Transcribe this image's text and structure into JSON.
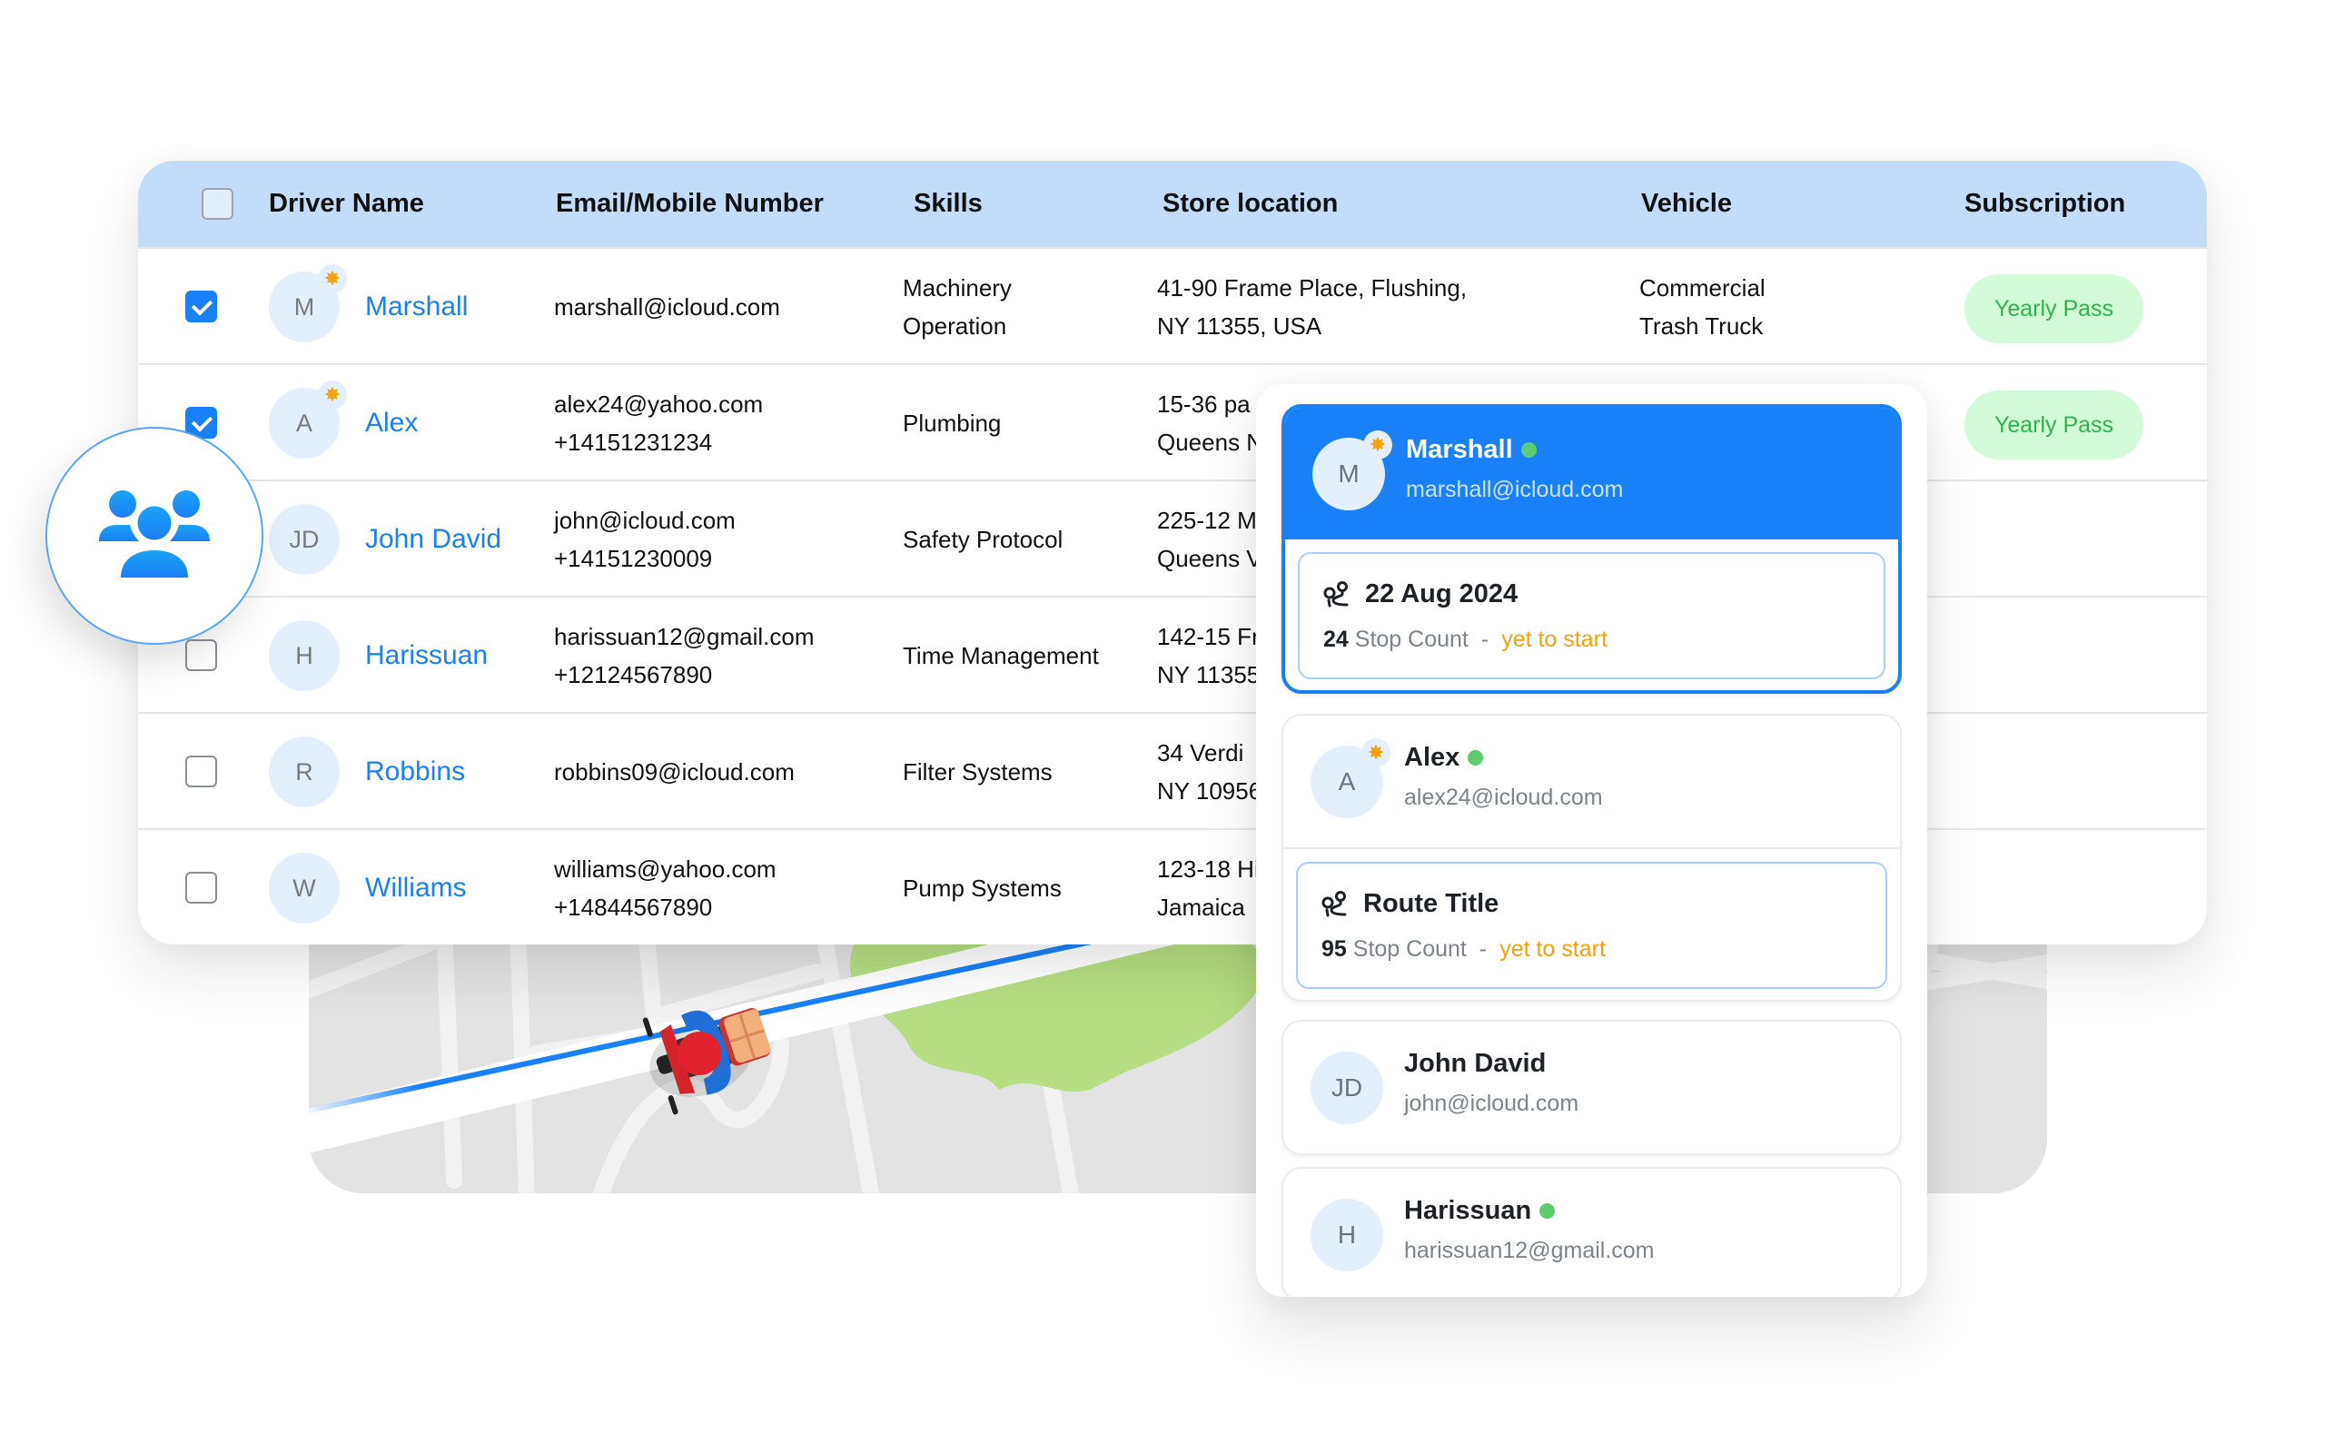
{
  "table": {
    "columns": [
      "Driver Name",
      "Email/Mobile Number",
      "Skills",
      "Store location",
      "Vehicle",
      "Subscription"
    ],
    "rows": [
      {
        "initials": "M",
        "name": "Marshall",
        "featured": true,
        "checked": true,
        "contact": [
          "marshall@icloud.com"
        ],
        "skills": [
          "Machinery",
          "Operation"
        ],
        "store": [
          "41-90 Frame Place, Flushing,",
          "NY 11355, USA"
        ],
        "vehicle": [
          "Commercial",
          "Trash Truck"
        ],
        "subscription": "Yearly Pass"
      },
      {
        "initials": "A",
        "name": "Alex",
        "featured": true,
        "checked": true,
        "contact": [
          "alex24@yahoo.com",
          "+14151231234"
        ],
        "skills": [
          "Plumbing"
        ],
        "store": [
          "15-36 pa",
          "Queens N"
        ],
        "vehicle": [],
        "subscription": "Yearly Pass"
      },
      {
        "initials": "JD",
        "name": "John David",
        "featured": false,
        "checked": null,
        "contact": [
          "john@icloud.com",
          "+14151230009"
        ],
        "skills": [
          "Safety Protocol"
        ],
        "store": [
          "225-12 M",
          "Queens V"
        ],
        "vehicle": [],
        "subscription": ""
      },
      {
        "initials": "H",
        "name": "Harissuan",
        "featured": false,
        "checked": false,
        "contact": [
          "harissuan12@gmail.com",
          "+12124567890"
        ],
        "skills": [
          "Time Management"
        ],
        "store": [
          "142-15 Fr",
          "NY 11355,"
        ],
        "vehicle": [],
        "subscription": ""
      },
      {
        "initials": "R",
        "name": "Robbins",
        "featured": false,
        "checked": false,
        "contact": [
          "robbins09@icloud.com"
        ],
        "skills": [
          "Filter Systems"
        ],
        "store": [
          "34 Verdi",
          "NY 10956"
        ],
        "vehicle": [],
        "subscription": ""
      },
      {
        "initials": "W",
        "name": "Williams",
        "featured": false,
        "checked": false,
        "contact": [
          "williams@yahoo.com",
          "+14844567890"
        ],
        "skills": [
          "Pump Systems"
        ],
        "store": [
          "123-18 Hi",
          "Jamaica"
        ],
        "vehicle": [],
        "subscription": ""
      }
    ]
  },
  "group_icon": "users-group-icon",
  "panel": {
    "drivers": [
      {
        "initials": "M",
        "name": "Marshall",
        "email": "marshall@icloud.com",
        "online": true,
        "featured": true,
        "active": true,
        "route": {
          "title": "22 Aug 2024",
          "stop_count": "24",
          "stop_label": "Stop Count",
          "separator": "-",
          "status": "yet to start"
        }
      },
      {
        "initials": "A",
        "name": "Alex",
        "email": "alex24@icloud.com",
        "online": true,
        "featured": true,
        "active": false,
        "route": {
          "title": "Route Title",
          "stop_count": "95",
          "stop_label": "Stop Count",
          "separator": "-",
          "status": "yet to start"
        }
      },
      {
        "initials": "JD",
        "name": "John David",
        "email": "john@icloud.com",
        "online": false,
        "featured": false,
        "active": false,
        "route": null
      },
      {
        "initials": "H",
        "name": "Harissuan",
        "email": "harissuan12@gmail.com",
        "online": true,
        "featured": false,
        "active": false,
        "route": null
      }
    ]
  },
  "colors": {
    "accent": "#1a80f7",
    "header_bg": "#c2ddfa",
    "pill_bg": "#d3fbd8",
    "pill_text": "#2bb44a",
    "status_pending": "#f4a10a",
    "online": "#5dcc6e",
    "avatar_bg": "#e4effd"
  }
}
